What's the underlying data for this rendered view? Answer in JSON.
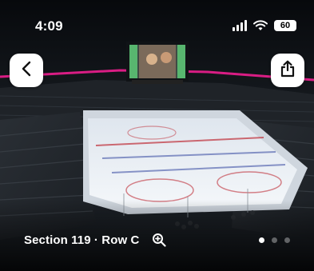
{
  "status_bar": {
    "time": "4:09",
    "battery": "60"
  },
  "header": {
    "back_icon": "chevron-left-icon",
    "share_icon": "share-icon"
  },
  "photo": {
    "seat_label": "Section 119 · Row C",
    "zoom_icon": "zoom-in-icon",
    "pagination": {
      "total": 3,
      "active_index": 0
    }
  },
  "colors": {
    "button_bg": "#ffffff",
    "accent_led": "#e51d8a",
    "ice": "#eef2f6"
  }
}
